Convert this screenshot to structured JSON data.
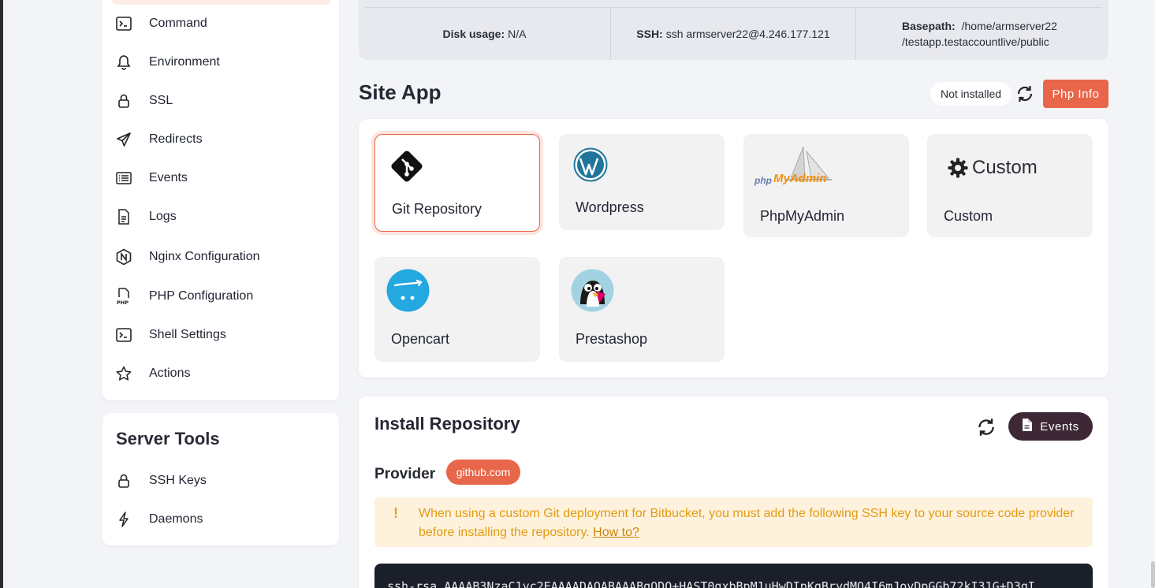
{
  "sidebar": {
    "items": [
      {
        "label": "Command",
        "icon": "terminal-icon"
      },
      {
        "label": "Environment",
        "icon": "bell-icon"
      },
      {
        "label": "SSL",
        "icon": "lock-icon"
      },
      {
        "label": "Redirects",
        "icon": "paper-plane-icon"
      },
      {
        "label": "Events",
        "icon": "list-icon"
      },
      {
        "label": "Logs",
        "icon": "file-icon"
      },
      {
        "label": "Nginx Configuration",
        "icon": "nginx-icon"
      },
      {
        "label": "PHP Configuration",
        "icon": "php-file-icon"
      },
      {
        "label": "Shell Settings",
        "icon": "terminal-icon"
      },
      {
        "label": "Actions",
        "icon": "star-icon"
      }
    ]
  },
  "server_tools": {
    "title": "Server Tools",
    "items": [
      {
        "label": "SSH Keys",
        "icon": "lock-icon"
      },
      {
        "label": "Daemons",
        "icon": "bolt-icon"
      }
    ]
  },
  "infobar": {
    "disk_label": "Disk usage:",
    "disk_value": "N/A",
    "ssh_label": "SSH:",
    "ssh_value": "ssh armserver22@4.246.177.121",
    "basepath_label": "Basepath:",
    "basepath_line1": "/home/armserver22",
    "basepath_line2": "/testapp.testaccountlive/public"
  },
  "site_app": {
    "title": "Site App",
    "status": "Not installed",
    "phpinfo_label": "Php Info",
    "apps": [
      {
        "name": "Git Repository",
        "selected": true
      },
      {
        "name": "Wordpress"
      },
      {
        "name": "PhpMyAdmin",
        "logo_text_php": "php",
        "logo_text_myadmin": "MyAdmin"
      },
      {
        "name": "Custom",
        "logo_text": "Custom"
      },
      {
        "name": "Opencart"
      },
      {
        "name": "Prestashop"
      }
    ]
  },
  "install_repo": {
    "title": "Install Repository",
    "events_label": "Events",
    "provider_label": "Provider",
    "provider_value": "github.com",
    "warning_text": "When using a custom Git deployment for Bitbucket, you must add the following SSH key to your source code provider before installing the repository.",
    "warning_link": "How to?",
    "ssh_key": "ssh-rsa AAAAB3NzaC1yc2EAAAADAQABAAABgQDQ+HAST0gxbBpM1uHwDIpKgBrydMO4I6mJoyDpGGb72kI31G+D3qI"
  },
  "colors": {
    "accent": "#e8664a",
    "events_button": "#3e2836",
    "warning_bg": "#fef2dd",
    "warning_text": "#e39b12"
  }
}
